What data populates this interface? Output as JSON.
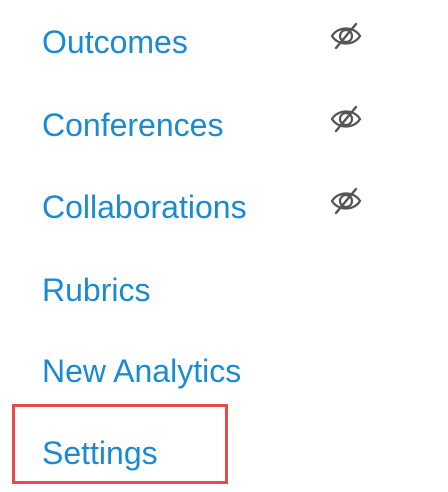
{
  "course_nav": {
    "items": [
      {
        "label": "Outcomes",
        "hidden_from_students": true,
        "status_icon": "eye-slash-icon"
      },
      {
        "label": "Conferences",
        "hidden_from_students": true,
        "status_icon": "eye-slash-icon"
      },
      {
        "label": "Collaborations",
        "hidden_from_students": true,
        "status_icon": "eye-slash-icon"
      },
      {
        "label": "Rubrics",
        "hidden_from_students": false
      },
      {
        "label": "New Analytics",
        "hidden_from_students": false
      },
      {
        "label": "Settings",
        "hidden_from_students": false,
        "highlighted": true
      }
    ]
  },
  "colors": {
    "link": "#1a8bd0",
    "icon": "#555555",
    "highlight": "#e84b4b"
  }
}
